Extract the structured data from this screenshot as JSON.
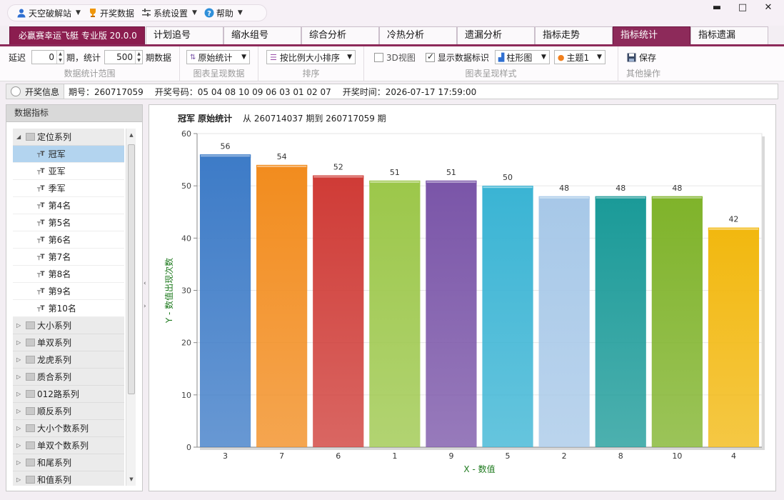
{
  "menu": {
    "site": "天空破解站",
    "lottery": "开奖数据",
    "settings": "系统设置",
    "help": "帮助"
  },
  "window_controls": {
    "minimize": "▬",
    "maximize": "□",
    "close": "✕"
  },
  "tabs": [
    {
      "label": "必赢赛幸运飞艇 专业版 20.0.0",
      "kind": "brand"
    },
    {
      "label": "计划追号"
    },
    {
      "label": "缩水组号"
    },
    {
      "label": "综合分析"
    },
    {
      "label": "冷热分析"
    },
    {
      "label": "遗漏分析"
    },
    {
      "label": "指标走势"
    },
    {
      "label": "指标统计",
      "active": true
    },
    {
      "label": "指标遗漏"
    }
  ],
  "ribbon": {
    "delay_label": "延迟",
    "delay_value": "0",
    "period_stat_label": "期，统计",
    "period_count_value": "500",
    "period_data_label": "期数据",
    "group1_caption": "数据统计范围",
    "display_combo": "原始统计",
    "group2_caption": "图表呈现数据",
    "sort_combo": "按比例大小排序",
    "group3_caption": "排序",
    "view3d_label": "3D视图",
    "view3d_checked": false,
    "show_labels_label": "显示数据标识",
    "show_labels_checked": true,
    "chart_type_combo": "柱形图",
    "theme_combo": "主题1",
    "group4_caption": "图表呈现样式",
    "save_label": "保存",
    "group5_caption": "其他操作"
  },
  "info": {
    "button": "开奖信息",
    "period": "期号：260717059",
    "numbers": "开奖号码：05 04 08 10 09 06 03 01 02 07",
    "time": "开奖时间：2026-07-17 17:59:00"
  },
  "left_panel": {
    "title": "数据指标",
    "groups": [
      {
        "label": "定位系列",
        "expanded": true,
        "items": [
          "冠军",
          "亚军",
          "季军",
          "第4名",
          "第5名",
          "第6名",
          "第7名",
          "第8名",
          "第9名",
          "第10名"
        ],
        "selected": 0
      },
      {
        "label": "大小系列"
      },
      {
        "label": "单双系列"
      },
      {
        "label": "龙虎系列"
      },
      {
        "label": "质合系列"
      },
      {
        "label": "012路系列"
      },
      {
        "label": "顺反系列"
      },
      {
        "label": "大小个数系列"
      },
      {
        "label": "单双个数系列"
      },
      {
        "label": "和尾系列"
      },
      {
        "label": "和值系列"
      }
    ]
  },
  "chart_data": {
    "type": "bar",
    "title": "冠军 原始统计",
    "subtitle": "从 260714037 期到 260717059 期",
    "xlabel": "X - 数值",
    "ylabel": "Y - 数值出现次数",
    "categories": [
      "3",
      "7",
      "6",
      "1",
      "9",
      "5",
      "2",
      "8",
      "10",
      "4"
    ],
    "values": [
      56,
      54,
      52,
      51,
      51,
      50,
      48,
      48,
      48,
      42
    ],
    "colors": [
      "#3d7bc7",
      "#f28c1e",
      "#cf3b36",
      "#9cc74a",
      "#7a55a8",
      "#3ab4d4",
      "#a7c8e8",
      "#1a9a98",
      "#7fb32a",
      "#f2b80f"
    ],
    "ylim": [
      0,
      60
    ],
    "yticks": [
      0,
      10,
      20,
      30,
      40,
      50,
      60
    ],
    "data_labels": true,
    "grid": true
  }
}
